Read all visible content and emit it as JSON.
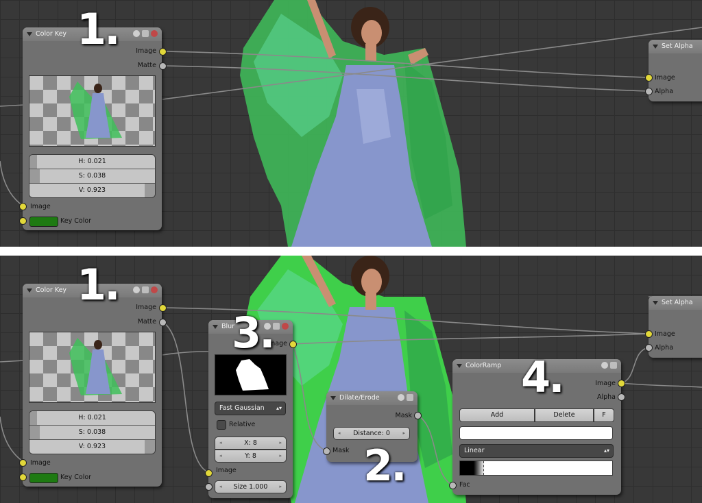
{
  "top": {
    "color_key": {
      "title": "Color Key",
      "out_image": "Image",
      "out_matte": "Matte",
      "h": "H: 0.021",
      "s": "S: 0.038",
      "v": "V: 0.923",
      "h_level": 0.021,
      "s_level": 0.038,
      "v_level": 0.923,
      "in_image": "Image",
      "in_key_color": "Key Color",
      "key_color": "#1e7a12"
    },
    "set_alpha": {
      "title": "Set Alpha",
      "in_image": "Image",
      "in_alpha": "Alpha"
    },
    "step_label": "1."
  },
  "bottom": {
    "color_key": {
      "title": "Color Key",
      "out_image": "Image",
      "out_matte": "Matte",
      "h": "H: 0.021",
      "s": "S: 0.038",
      "v": "V: 0.923",
      "in_image": "Image",
      "in_key_color": "Key Color",
      "key_color": "#1e7a12"
    },
    "blur": {
      "title": "Blur",
      "out_image": "Image",
      "filter_type": "Fast Gaussian",
      "relative": "Relative",
      "x": "X: 8",
      "y": "Y: 8",
      "in_image": "Image",
      "size": "Size 1.000"
    },
    "dilate": {
      "title": "Dilate/Erode",
      "out_mask": "Mask",
      "distance": "Distance: 0",
      "in_mask": "Mask"
    },
    "color_ramp": {
      "title": "ColorRamp",
      "out_image": "Image",
      "out_alpha": "Alpha",
      "add": "Add",
      "delete": "Delete",
      "f": "F",
      "interpolation": "Linear",
      "in_fac": "Fac"
    },
    "set_alpha": {
      "title": "Set Alpha",
      "in_image": "Image",
      "in_alpha": "Alpha"
    },
    "step_labels": [
      "1.",
      "3.",
      "2.",
      "4."
    ]
  },
  "colors": {
    "socket_image": "#e2d83a",
    "socket_value": "#b8b8b8",
    "background": "#383838",
    "dress": "#8a9ad0",
    "veil": "#40c060"
  },
  "icons": [
    "collapse-triangle-icon",
    "preview-toggle-icon",
    "options-icon",
    "close-icon"
  ]
}
